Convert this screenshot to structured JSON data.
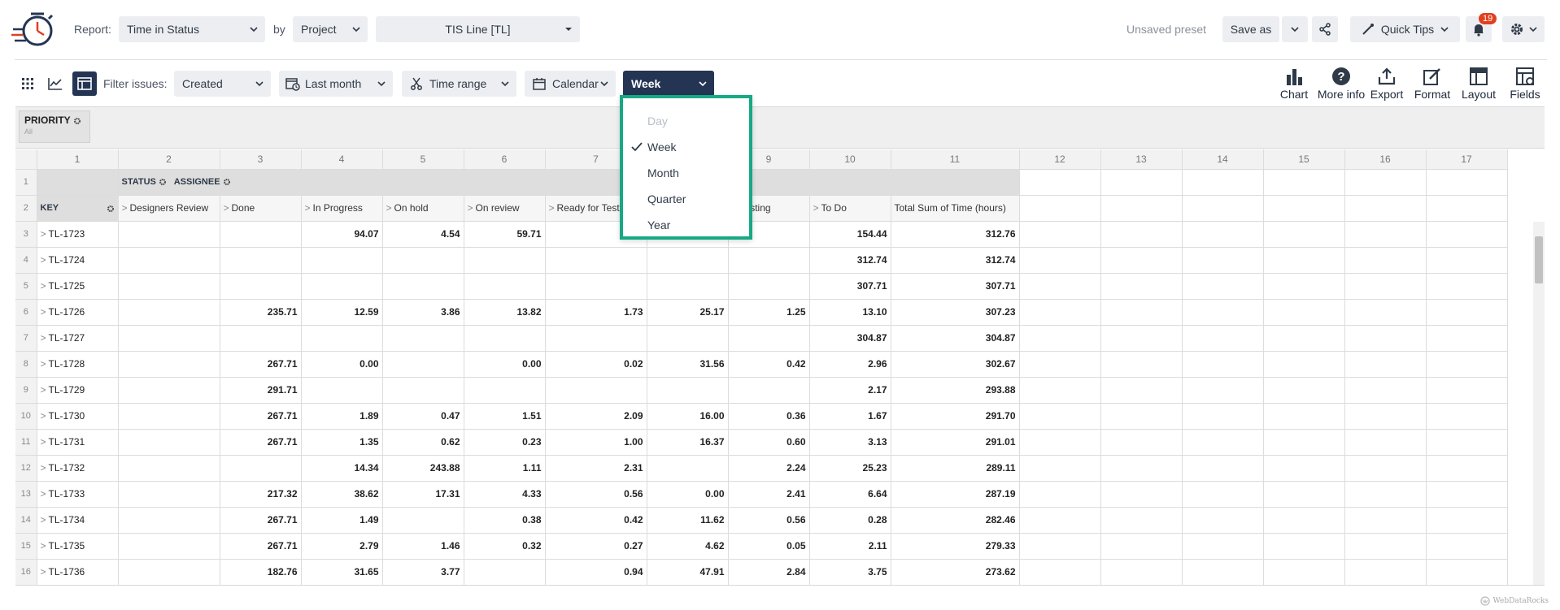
{
  "colors": {
    "accent_dark": "#243554",
    "dropdown_border": "#17a884",
    "badge": "#e0401f"
  },
  "topbar": {
    "report_label": "Report:",
    "report_value": "Time in Status",
    "by_label": "by",
    "by_value": "Project",
    "project_value": "TIS Line [TL]",
    "unsaved_preset": "Unsaved preset",
    "save_as": "Save as",
    "quick_tips": "Quick Tips",
    "notifications_count": "19",
    "icons": [
      "logo-clock-icon",
      "share-icon",
      "quick-tips-icon",
      "bell-icon",
      "gear-icon"
    ]
  },
  "toolbar": {
    "filter_label": "Filter issues:",
    "filter_value": "Created",
    "period_value": "Last month",
    "time_range": "Time range",
    "calendar": "Calendar",
    "granularity": "Week",
    "tools": [
      "Chart",
      "More info",
      "Export",
      "Format",
      "Layout",
      "Fields"
    ]
  },
  "dropdown": {
    "items": [
      "Day",
      "Week",
      "Month",
      "Quarter",
      "Year"
    ],
    "selected": "Week",
    "disabled": "Day"
  },
  "grid": {
    "priority": {
      "label": "PRIORITY",
      "sub": "All"
    },
    "column_numbers": [
      "1",
      "2",
      "3",
      "4",
      "5",
      "6",
      "7",
      "8",
      "9",
      "10",
      "11",
      "12",
      "13",
      "14",
      "15",
      "16",
      "17"
    ],
    "row1": {
      "status": "STATUS",
      "assignee": "ASSIGNEE"
    },
    "row2": {
      "key": "KEY",
      "headers": [
        "Designers Review",
        "Done",
        "In Progress",
        "On hold",
        "On review",
        "Ready for Test",
        "",
        "Testing",
        "To Do",
        "Total Sum of Time (hours)"
      ]
    },
    "rows": [
      {
        "n": "3",
        "key": "TL-1723",
        "v": [
          "",
          "",
          "94.07",
          "4.54",
          "59.71",
          "",
          "",
          "",
          "154.44",
          "312.76"
        ]
      },
      {
        "n": "4",
        "key": "TL-1724",
        "v": [
          "",
          "",
          "",
          "",
          "",
          "",
          "",
          "",
          "312.74",
          "312.74"
        ]
      },
      {
        "n": "5",
        "key": "TL-1725",
        "v": [
          "",
          "",
          "",
          "",
          "",
          "",
          "",
          "",
          "307.71",
          "307.71"
        ]
      },
      {
        "n": "6",
        "key": "TL-1726",
        "v": [
          "",
          "235.71",
          "12.59",
          "3.86",
          "13.82",
          "1.73",
          "25.17",
          "1.25",
          "13.10",
          "307.23"
        ]
      },
      {
        "n": "7",
        "key": "TL-1727",
        "v": [
          "",
          "",
          "",
          "",
          "",
          "",
          "",
          "",
          "304.87",
          "304.87"
        ]
      },
      {
        "n": "8",
        "key": "TL-1728",
        "v": [
          "",
          "267.71",
          "0.00",
          "",
          "0.00",
          "0.02",
          "31.56",
          "0.42",
          "2.96",
          "302.67"
        ]
      },
      {
        "n": "9",
        "key": "TL-1729",
        "v": [
          "",
          "291.71",
          "",
          "",
          "",
          "",
          "",
          "",
          "2.17",
          "293.88"
        ]
      },
      {
        "n": "10",
        "key": "TL-1730",
        "v": [
          "",
          "267.71",
          "1.89",
          "0.47",
          "1.51",
          "2.09",
          "16.00",
          "0.36",
          "1.67",
          "291.70"
        ]
      },
      {
        "n": "11",
        "key": "TL-1731",
        "v": [
          "",
          "267.71",
          "1.35",
          "0.62",
          "0.23",
          "1.00",
          "16.37",
          "0.60",
          "3.13",
          "291.01"
        ]
      },
      {
        "n": "12",
        "key": "TL-1732",
        "v": [
          "",
          "",
          "14.34",
          "243.88",
          "1.11",
          "2.31",
          "",
          "2.24",
          "25.23",
          "289.11"
        ]
      },
      {
        "n": "13",
        "key": "TL-1733",
        "v": [
          "",
          "217.32",
          "38.62",
          "17.31",
          "4.33",
          "0.56",
          "0.00",
          "2.41",
          "6.64",
          "287.19"
        ]
      },
      {
        "n": "14",
        "key": "TL-1734",
        "v": [
          "",
          "267.71",
          "1.49",
          "",
          "0.38",
          "0.42",
          "11.62",
          "0.56",
          "0.28",
          "282.46"
        ]
      },
      {
        "n": "15",
        "key": "TL-1735",
        "v": [
          "",
          "267.71",
          "2.79",
          "1.46",
          "0.32",
          "0.27",
          "4.62",
          "0.05",
          "2.11",
          "279.33"
        ]
      },
      {
        "n": "16",
        "key": "TL-1736",
        "v": [
          "",
          "182.76",
          "31.65",
          "3.77",
          "",
          "0.94",
          "47.91",
          "2.84",
          "3.75",
          "273.62"
        ]
      }
    ]
  },
  "watermark": "WebDataRocks"
}
